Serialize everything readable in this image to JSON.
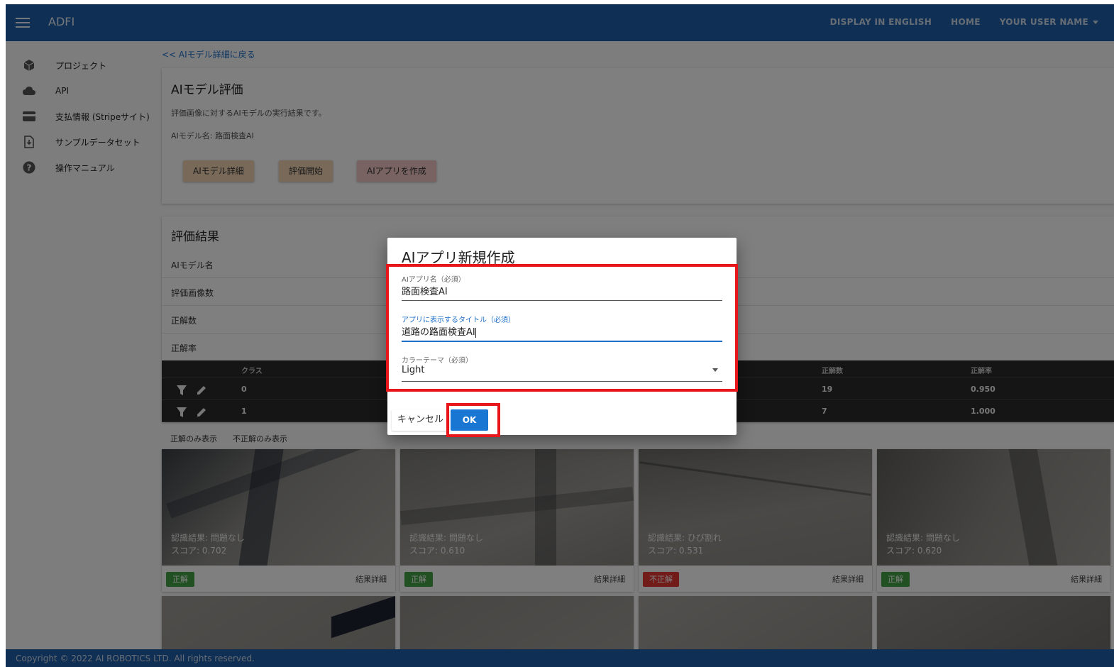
{
  "topbar": {
    "brand": "ADFI",
    "nav": [
      "DISPLAY IN ENGLISH",
      "HOME",
      "YOUR USER NAME"
    ]
  },
  "sidebar": {
    "items": [
      {
        "label": "プロジェクト",
        "icon": "cube-icon"
      },
      {
        "label": "API",
        "icon": "cloud-icon"
      },
      {
        "label": "支払情報 (Stripeサイト)",
        "icon": "credit-card-icon"
      },
      {
        "label": "サンプルデータセット",
        "icon": "file-download-icon"
      },
      {
        "label": "操作マニュアル",
        "icon": "help-icon"
      }
    ]
  },
  "main": {
    "back_link": "<< AIモデル詳細に戻る",
    "eval_card": {
      "title": "AIモデル評価",
      "desc": "評価画像に対するAIモデルの実行結果です。",
      "model_name_line": "AIモデル名: 路面検査AI",
      "buttons": [
        "AIモデル詳細",
        "評価開始",
        "AIアプリを作成"
      ]
    },
    "result_card": {
      "title": "評価結果",
      "rows": [
        "AIモデル名",
        "評価画像数",
        "正解数",
        "正解率"
      ]
    },
    "table": {
      "headers": {
        "class": "クラス",
        "correct": "正解数",
        "rate": "正解率"
      },
      "rows": [
        {
          "class": "0",
          "correct": "19",
          "rate": "0.950"
        },
        {
          "class": "1",
          "correct": "7",
          "rate": "1.000"
        }
      ]
    },
    "filters": [
      "正解のみ表示",
      "不正解のみ表示"
    ],
    "images": [
      {
        "result": "認識結果: 問題なし",
        "score": "スコア: 0.702",
        "badge": "正解",
        "detail": "結果詳細"
      },
      {
        "result": "認識結果: 問題なし",
        "score": "スコア: 0.610",
        "badge": "正解",
        "detail": "結果詳細"
      },
      {
        "result": "認識結果: ひび割れ",
        "score": "スコア: 0.531",
        "badge": "不正解",
        "detail": "結果詳細"
      },
      {
        "result": "認識結果: 問題なし",
        "score": "スコア: 0.620",
        "badge": "正解",
        "detail": "結果詳細"
      }
    ]
  },
  "footer": {
    "text": "Copyright © 2022 AI ROBOTICS LTD. All rights reserved."
  },
  "dialog": {
    "title": "AIアプリ新規作成",
    "fields": [
      {
        "label": "AIアプリ名（必須）",
        "value": "路面検査AI"
      },
      {
        "label": "アプリに表示するタイトル（必須）",
        "value": "道路の路面検査AI"
      },
      {
        "label": "カラーテーマ（必須）",
        "value": "Light"
      }
    ],
    "cancel": "キャンセル",
    "ok": "OK"
  },
  "colors": {
    "primary": "#1f5fa8",
    "ok_button": "#1976d2",
    "highlight": "#e8161b",
    "correct": "#43a047",
    "incorrect": "#e53935"
  }
}
